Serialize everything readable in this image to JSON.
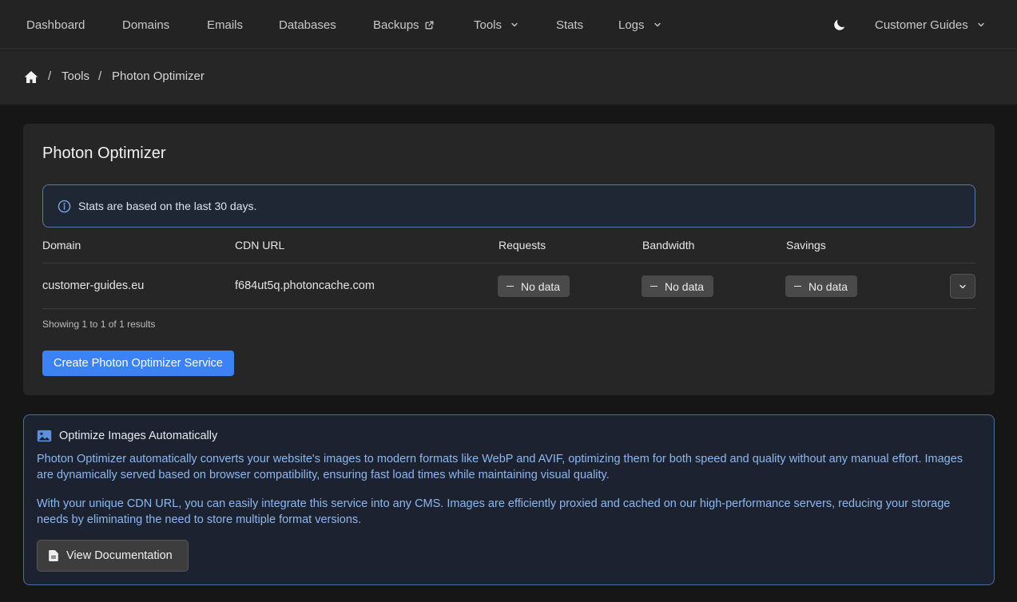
{
  "nav": {
    "dashboard": "Dashboard",
    "domains": "Domains",
    "emails": "Emails",
    "databases": "Databases",
    "backups": "Backups",
    "tools": "Tools",
    "stats": "Stats",
    "logs": "Logs",
    "account": "Customer Guides"
  },
  "breadcrumb": {
    "tools": "Tools",
    "current": "Photon Optimizer",
    "separator": "/"
  },
  "card": {
    "title": "Photon Optimizer",
    "info": "Stats are based on the last 30 days.",
    "table": {
      "headers": {
        "domain": "Domain",
        "cdn_url": "CDN URL",
        "requests": "Requests",
        "bandwidth": "Bandwidth",
        "savings": "Savings"
      },
      "rows": [
        {
          "domain": "customer-guides.eu",
          "cdn_url": "f684ut5q.photoncache.com",
          "requests": "No data",
          "bandwidth": "No data",
          "savings": "No data"
        }
      ]
    },
    "results_text": "Showing 1 to 1 of 1 results",
    "create_button": "Create Photon Optimizer Service"
  },
  "panel": {
    "title": "Optimize Images Automatically",
    "paragraph1": "Photon Optimizer automatically converts your website's images to modern formats like WebP and AVIF, optimizing them for both speed and quality without any manual effort. Images are dynamically served based on browser compatibility, ensuring fast load times while maintaining visual quality.",
    "paragraph2": "With your unique CDN URL, you can easily integrate this service into any CMS. Images are efficiently proxied and cached on our high-performance servers, reducing your storage needs by eliminating the need to store multiple format versions.",
    "doc_button": "View Documentation"
  },
  "colors": {
    "accent": "#3b82f6",
    "panel_text": "#8db7ef",
    "panel_border": "#4f6c98"
  }
}
